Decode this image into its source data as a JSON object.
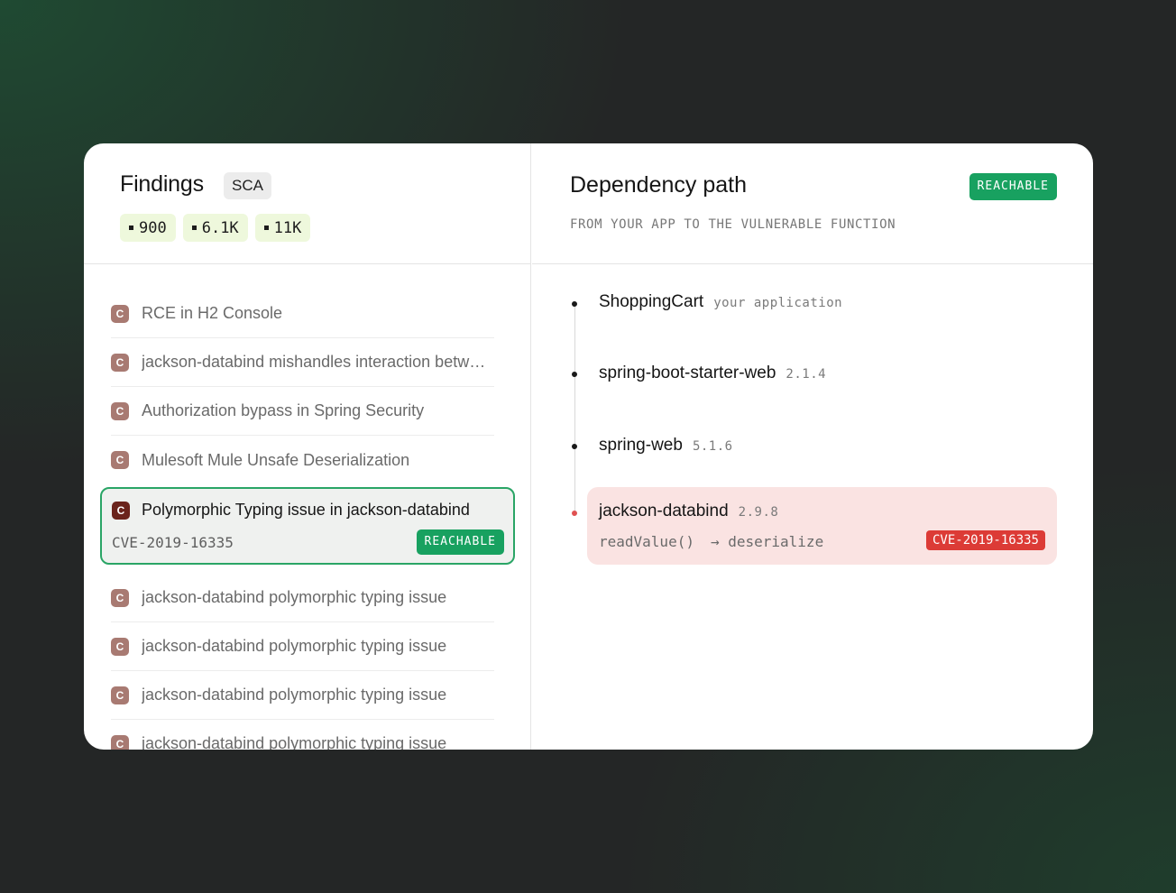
{
  "findings": {
    "title": "Findings",
    "badge": "SCA",
    "stats": [
      "900",
      "6.1K",
      "11K"
    ],
    "items_before": [
      "RCE in H2 Console",
      "jackson-databind mishandles interaction betw…",
      "Authorization bypass in Spring Security",
      "Mulesoft Mule Unsafe Deserialization"
    ],
    "selected": {
      "label": "Polymorphic Typing issue in jackson-databind",
      "cve": "CVE-2019-16335",
      "status": "REACHABLE"
    },
    "items_after": [
      "jackson-databind polymorphic typing issue",
      "jackson-databind polymorphic typing issue",
      "jackson-databind polymorphic typing issue",
      "jackson-databind polymorphic typing issue"
    ],
    "icon_letter": "C"
  },
  "dependency": {
    "title": "Dependency path",
    "status": "REACHABLE",
    "subtitle": "FROM YOUR APP TO THE VULNERABLE FUNCTION",
    "nodes": [
      {
        "name": "ShoppingCart",
        "meta": "your application"
      },
      {
        "name": "spring-boot-starter-web",
        "meta": "2.1.4"
      },
      {
        "name": "spring-web",
        "meta": "5.1.6"
      }
    ],
    "vulnerable": {
      "name": "jackson-databind",
      "version": "2.9.8",
      "call_from": "readValue()",
      "call_to": "→ deserialize",
      "cve": "CVE-2019-16335"
    }
  },
  "colors": {
    "accent_green": "#18a160",
    "danger_red": "#dc3b36",
    "stat_bg": "#eef8dc",
    "vuln_bg": "#fae3e2"
  }
}
